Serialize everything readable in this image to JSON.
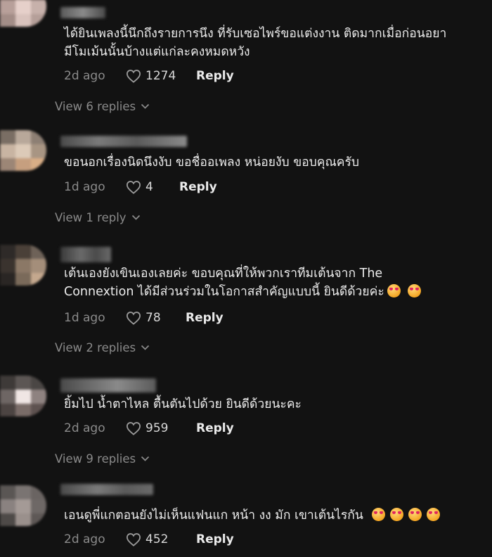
{
  "comments": [
    {
      "text": "ได้ยินเพลงนี้นึกถึงรายการนึง ที่รับเซอไพร์ขอแต่งงาน ติดมากเมื่อก่อนอยา\nมีโมเม้นนั้นบ้างแต่แก่ละคงหมดหวัง",
      "emojis": [],
      "time": "2d ago",
      "likes": "1274",
      "reply_label": "Reply",
      "view_replies": "View 6 replies"
    },
    {
      "text": "ขอนอกเรื่องนิดนึงงับ ขอชื่ออเพลง หน่อยงับ ขอบคุณครับ",
      "emojis": [],
      "time": "1d ago",
      "likes": "4",
      "reply_label": "Reply",
      "view_replies": "View 1 reply"
    },
    {
      "text": "เต้นเองยังเขินเองเลยค่ะ ขอบคุณที่ให้พวกเราทีมเต้นจาก The\nConnextion ได้มีส่วนร่วมในโอกาสสำคัญแบบนี้ ยินดีด้วยค่ะ",
      "emojis": [
        "smiling-face-with-heart-eyes",
        "smiling-face-with-heart-eyes"
      ],
      "time": "1d ago",
      "likes": "78",
      "reply_label": "Reply",
      "view_replies": "View 2 replies"
    },
    {
      "text": "ยิ้มไป น้ำตาไหล ตื้นตันไปด้วย ยินดีด้วยนะคะ",
      "emojis": [],
      "time": "2d ago",
      "likes": "959",
      "reply_label": "Reply",
      "view_replies": "View 9 replies"
    },
    {
      "text": "เอนดูพี่แกตอนยังไม่เห็นแฟนแก หน้า งง มัก เขาเต้นไรกัน",
      "emojis": [
        "smiling-face-with-heart-eyes",
        "smiling-face-with-heart-eyes",
        "smiling-face-with-heart-eyes",
        "smiling-face-with-heart-eyes"
      ],
      "time": "2d ago",
      "likes": "452",
      "reply_label": "Reply"
    }
  ],
  "icons": {
    "like": "heart-outline-icon",
    "expand": "chevron-down-icon"
  },
  "colors": {
    "background": "#121212",
    "text": "#ececec",
    "muted": "#8a8a8a"
  }
}
